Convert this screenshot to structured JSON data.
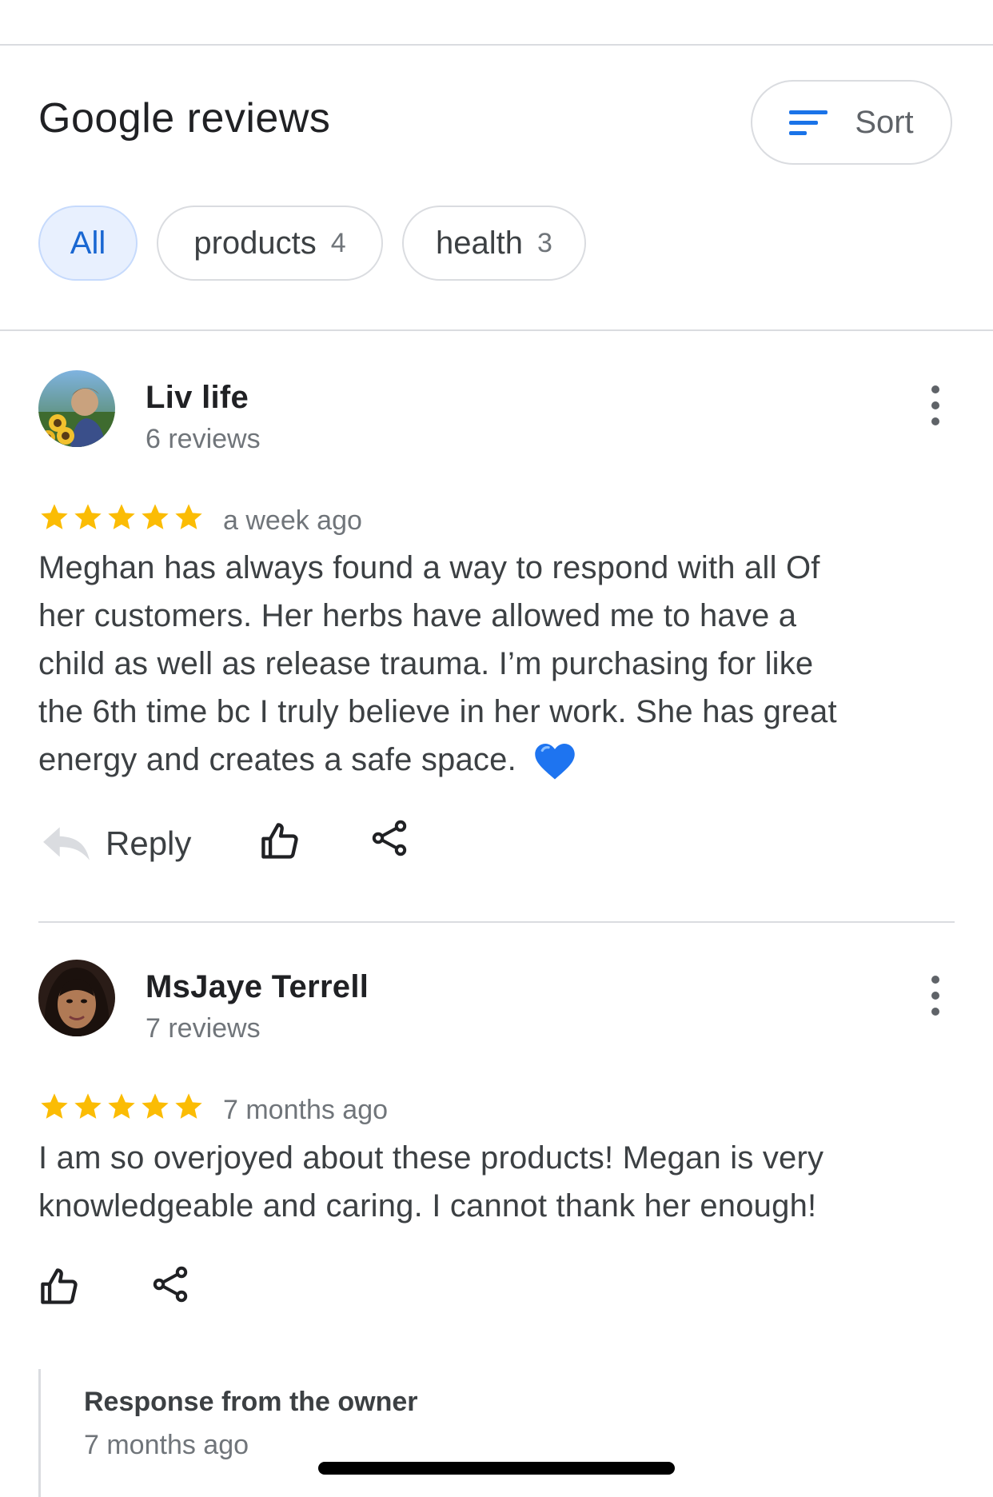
{
  "header": {
    "title": "Google reviews",
    "sort_label": "Sort"
  },
  "filters": [
    {
      "label": "All",
      "count": "",
      "active": true
    },
    {
      "label": "products",
      "count": "4",
      "active": false
    },
    {
      "label": "health",
      "count": "3",
      "active": false
    }
  ],
  "reviews": [
    {
      "author": "Liv life",
      "meta": "6 reviews",
      "rating": 5,
      "time": "a week ago",
      "text_lines": [
        "Meghan has always found a way to respond with all Of",
        "her customers. Her herbs have allowed me to have a",
        "child as well as release trauma. I’m purchasing for like",
        "the 6th time bc I truly believe in her work. She has great",
        "energy and creates a safe space."
      ],
      "emoji": "blue-heart",
      "reply_label": "Reply"
    },
    {
      "author": "MsJaye Terrell",
      "meta": "7 reviews",
      "rating": 5,
      "time": "7 months ago",
      "text_lines": [
        "I am so overjoyed about these products! Megan is very",
        "knowledgeable and caring. I cannot thank her enough!"
      ]
    }
  ],
  "owner_response": {
    "title": "Response from the owner",
    "time": "7 months ago"
  },
  "colors": {
    "accent": "#1a73e8",
    "star": "#fbbc04",
    "chip_active_bg": "#e8f0fe",
    "heart": "#1e74f0"
  },
  "icons": [
    "sort-icon",
    "more-vert-icon",
    "star-icon",
    "reply-icon",
    "thumb-up-icon",
    "share-icon",
    "blue-heart-icon"
  ]
}
